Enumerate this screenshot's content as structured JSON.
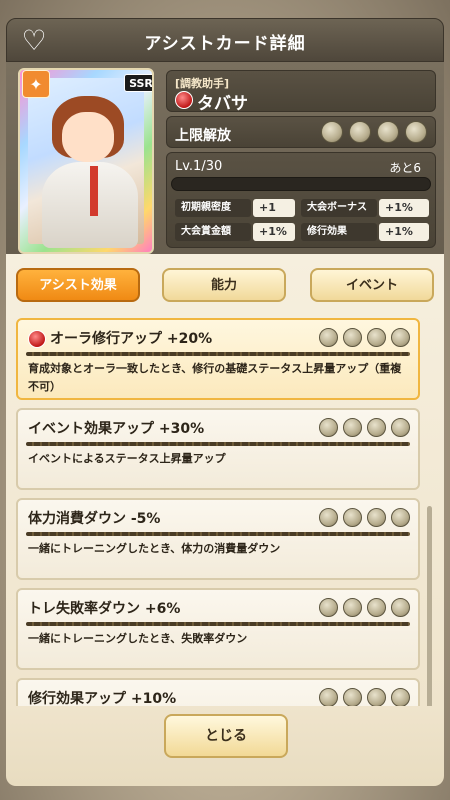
{
  "header": {
    "title": "アシストカード詳細",
    "favorite_icon": "heart-outline-icon"
  },
  "card": {
    "rarity": "SSR",
    "type_icon": "handshake-icon",
    "epithet": "[調教助手]",
    "name": "タバサ",
    "limit_label": "上限解放",
    "limit_coins": 4,
    "level": "Lv.1/30",
    "remaining": "あと6",
    "stats": [
      {
        "label": "初期親密度",
        "value": "+1"
      },
      {
        "label": "大会ボーナス",
        "value": "+1%"
      },
      {
        "label": "大会賞金額",
        "value": "+1%"
      },
      {
        "label": "修行効果",
        "value": "+1%"
      }
    ]
  },
  "tabs": [
    {
      "label": "アシスト効果",
      "active": true
    },
    {
      "label": "能力",
      "active": false
    },
    {
      "label": "イベント",
      "active": false
    }
  ],
  "effects": [
    {
      "title": "オーラ修行アップ +20%",
      "desc": "育成対象とオーラ一致したとき、修行の基礎ステータス上昇量アップ（重複不可）",
      "icon": true
    },
    {
      "title": "イベント効果アップ +30%",
      "desc": "イベントによるステータス上昇量アップ",
      "icon": false
    },
    {
      "title": "体力消費ダウン -5%",
      "desc": "一緒にトレーニングしたとき、体力の消費量ダウン",
      "icon": false
    },
    {
      "title": "トレ失敗率ダウン +6%",
      "desc": "一緒にトレーニングしたとき、失敗率ダウン",
      "icon": false
    },
    {
      "title": "修行効果アップ +10%",
      "desc": "",
      "icon": false
    }
  ],
  "footer": {
    "close_label": "とじる"
  }
}
